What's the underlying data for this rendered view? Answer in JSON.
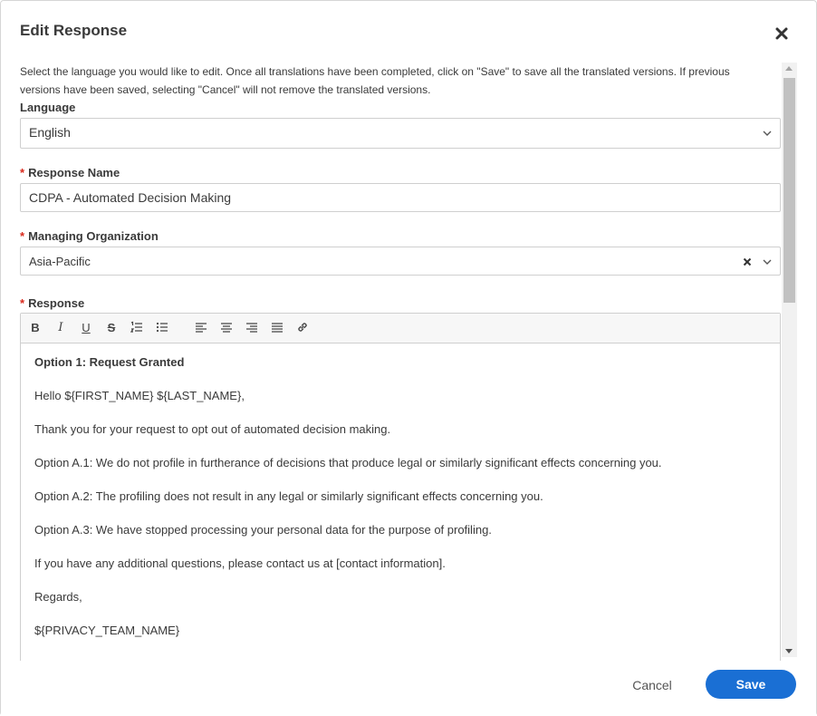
{
  "dialog": {
    "title": "Edit Response",
    "close_icon": "close-icon"
  },
  "intro_text": "Select the language you would like to edit. Once all translations have been completed, click on \"Save\" to save all the translated versions. If previous versions have been saved, selecting \"Cancel\" will not remove the translated versions.",
  "language": {
    "label": "Language",
    "value": "English"
  },
  "response_name": {
    "label": "Response Name",
    "required_marker": "*",
    "value": "CDPA - Automated Decision Making"
  },
  "managing_org": {
    "label": "Managing Organization",
    "required_marker": "*",
    "value": "Asia-Pacific"
  },
  "response": {
    "label": "Response",
    "required_marker": "*",
    "toolbar": [
      {
        "name": "bold-icon",
        "glyph": "B"
      },
      {
        "name": "italic-icon",
        "glyph": "I"
      },
      {
        "name": "underline-icon",
        "glyph": "U"
      },
      {
        "name": "strikethrough-icon",
        "glyph": "S"
      },
      {
        "name": "ordered-list-icon"
      },
      {
        "name": "bullet-list-icon"
      },
      {
        "name": "align-left-icon"
      },
      {
        "name": "align-center-icon"
      },
      {
        "name": "align-right-icon"
      },
      {
        "name": "align-justify-icon"
      },
      {
        "name": "link-icon"
      }
    ],
    "paragraphs": [
      "Option 1: Request Granted",
      "Hello ${FIRST_NAME} ${LAST_NAME},",
      "Thank you for your request to opt out of automated decision making.",
      "Option A.1: We do not profile in furtherance of decisions that produce legal or similarly significant effects concerning you.",
      "Option A.2: The profiling does not result in any legal or similarly significant effects concerning you.",
      "Option A.3: We have stopped processing your personal data for the purpose of profiling.",
      "If you have any additional questions, please contact us at [contact information].",
      "Regards,",
      "${PRIVACY_TEAM_NAME}"
    ]
  },
  "footer": {
    "cancel_label": "Cancel",
    "save_label": "Save"
  },
  "colors": {
    "accent": "#1a6fd4",
    "required": "#d9291c"
  }
}
